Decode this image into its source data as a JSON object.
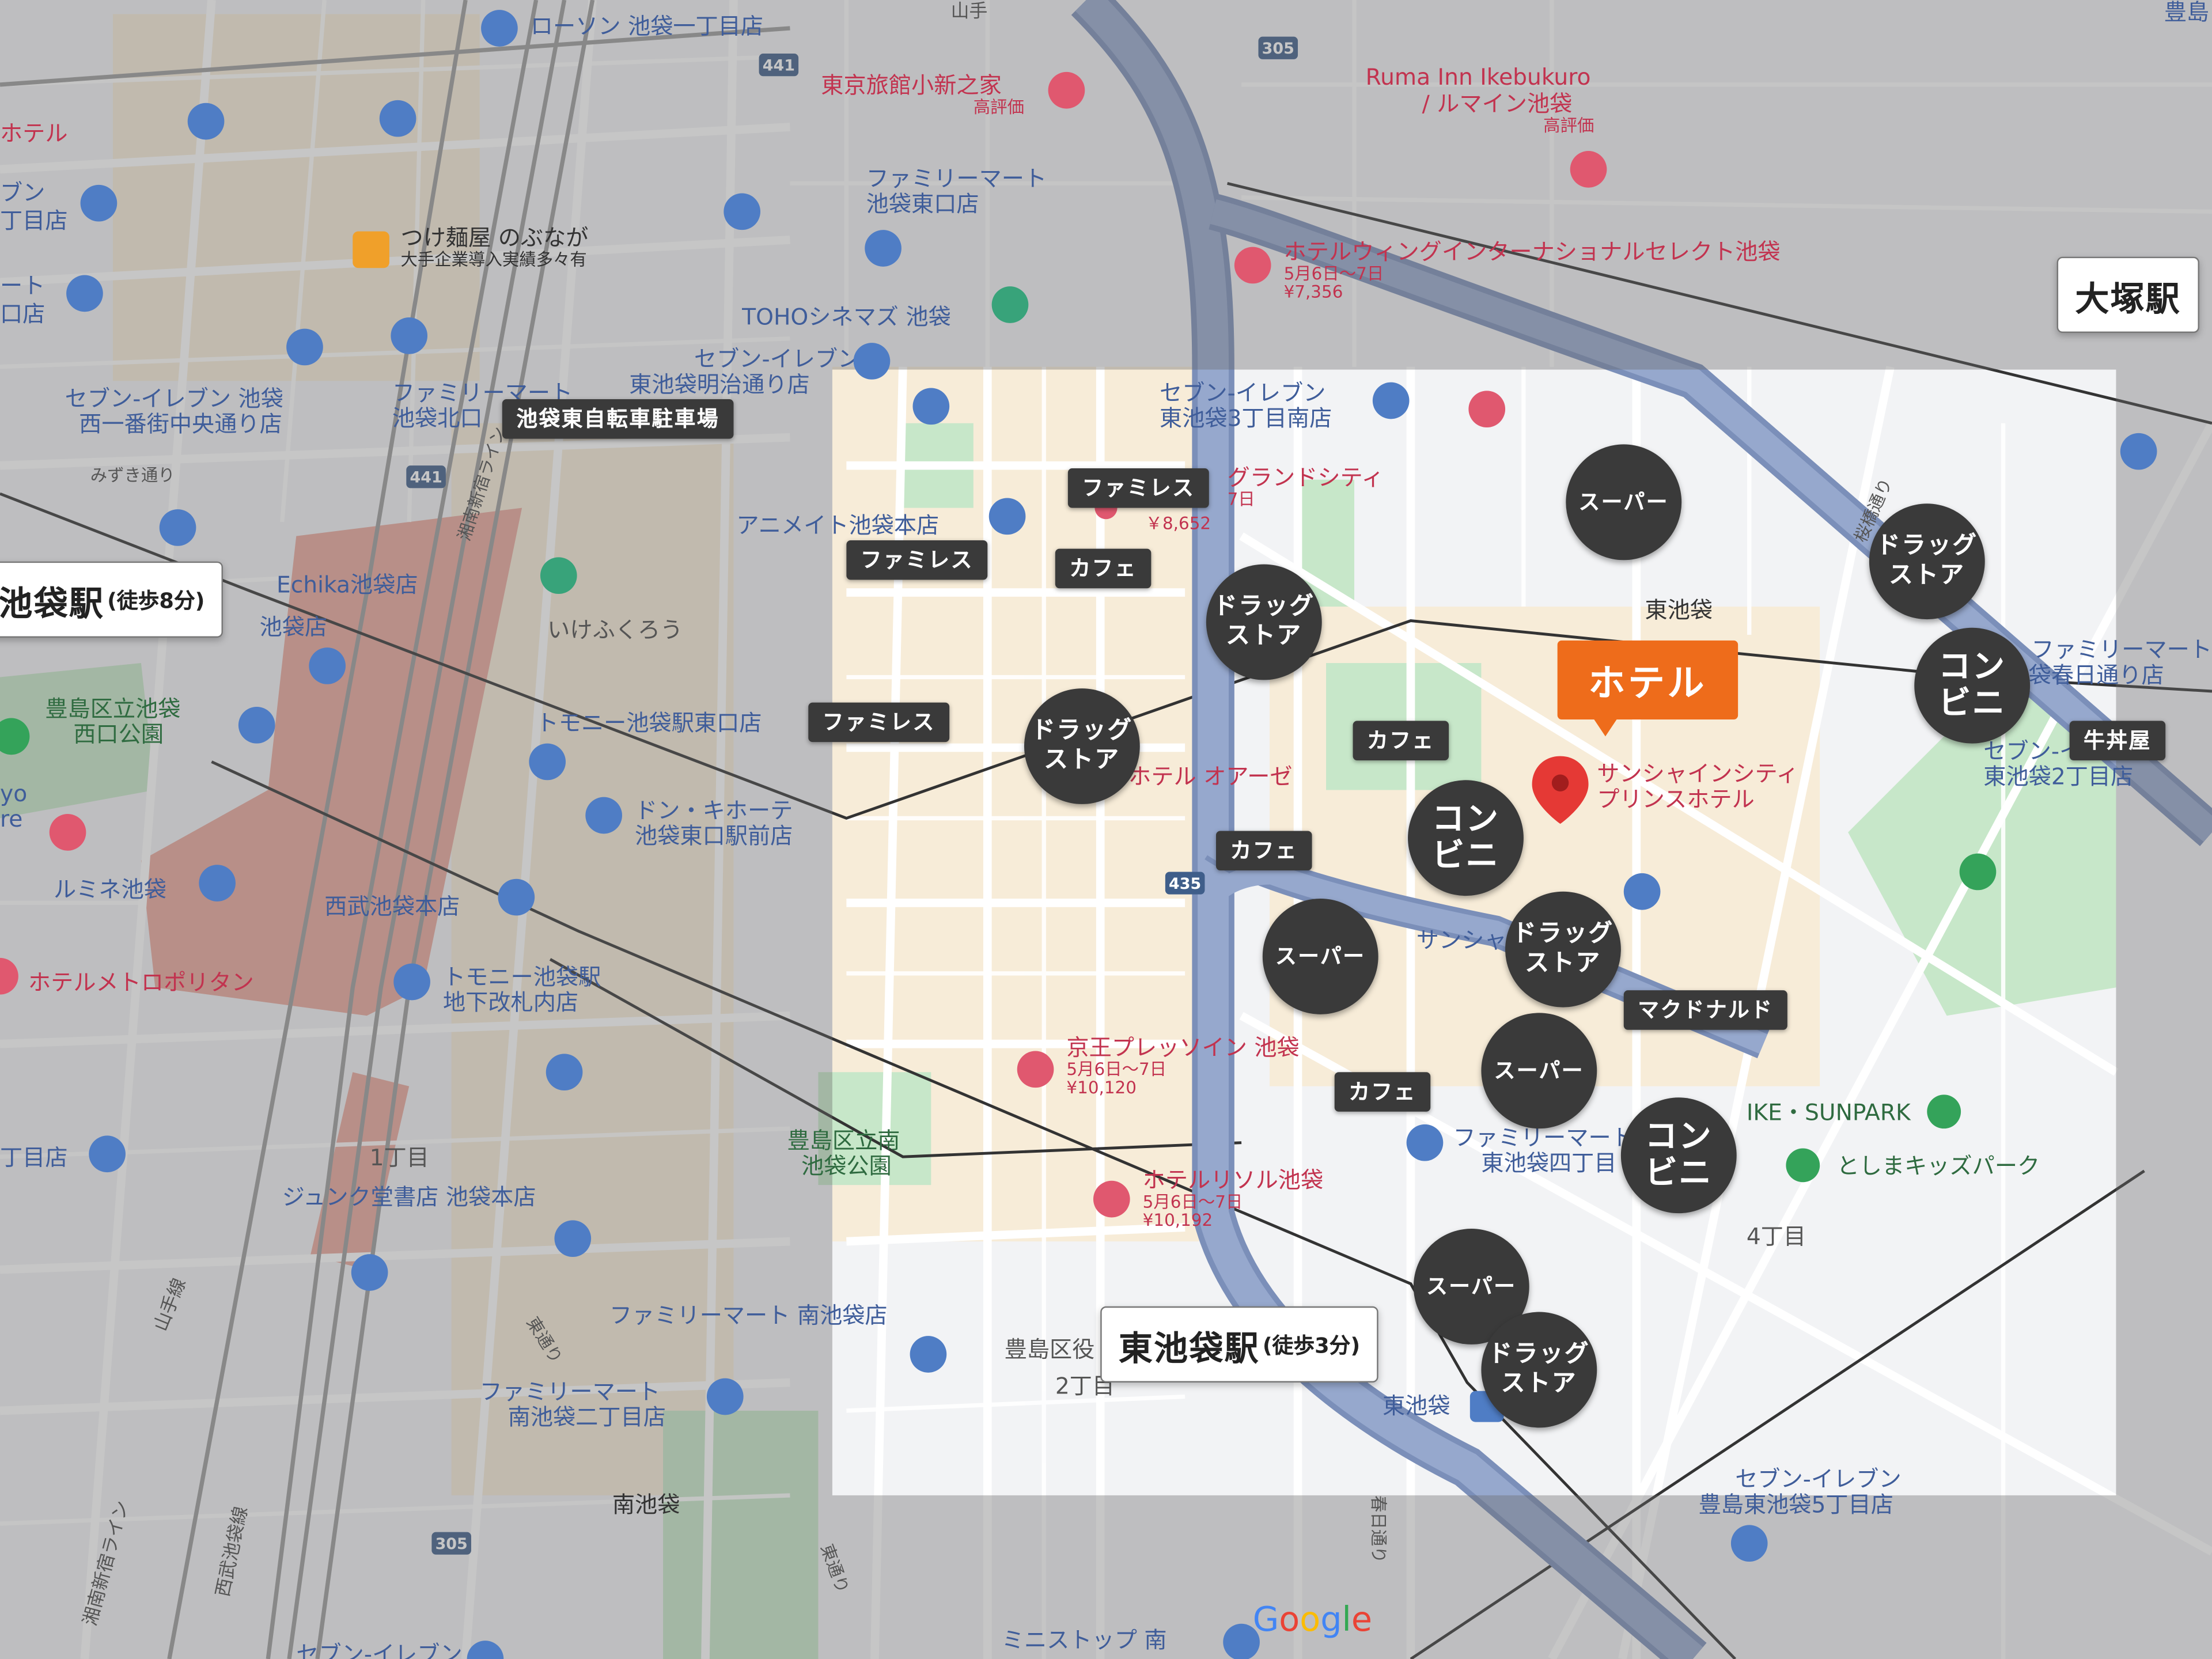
{
  "map_labels": [
    {
      "id": "lawson",
      "text": "ローソン 池袋一丁目店",
      "kind": "blue",
      "poi": "convenience-store-icon"
    },
    {
      "id": "ryokan",
      "text": "東京旅館小新之家",
      "sub": "高評価",
      "kind": "red",
      "poi": "hotel-icon"
    },
    {
      "id": "ruma1",
      "text": "Ruma Inn Ikebukuro",
      "kind": "red"
    },
    {
      "id": "ruma2",
      "text": "/ ルマイン池袋",
      "sub": "高評価",
      "kind": "red",
      "poi": "hotel-icon"
    },
    {
      "id": "hotel_left",
      "text": "ホテル",
      "kind": "red"
    },
    {
      "id": "fm_east",
      "text": "ファミリーマート",
      "sub2": "池袋東口店",
      "kind": "blue",
      "poi": "convenience-store-icon"
    },
    {
      "id": "tsukemen",
      "text": "つけ麺屋 のぶなが",
      "sub": "大手企業導入実績多々有",
      "kind": "dark",
      "poi": "restaurant-icon"
    },
    {
      "id": "wing",
      "text": "ホテルウィングインターナショナルセレクト池袋",
      "sub": "5月6日～7日",
      "sub3": "¥7,356",
      "kind": "red",
      "poi": "hotel-icon"
    },
    {
      "id": "toho",
      "text": "TOHOシネマズ 池袋",
      "kind": "blue",
      "poi": "cinema-icon"
    },
    {
      "id": "bun",
      "text": "ブン",
      "kind": "blue"
    },
    {
      "id": "chome_l",
      "text": "丁目店",
      "kind": "blue"
    },
    {
      "id": "to",
      "text": "ート",
      "kind": "blue"
    },
    {
      "id": "kuchiten",
      "text": "口店",
      "kind": "blue"
    },
    {
      "id": "seven_meiji",
      "text": "セブン-イレブン",
      "sub2": "東池袋明治通り店",
      "kind": "blue",
      "poi": "convenience-store-icon"
    },
    {
      "id": "seven_nishi",
      "text": "セブン-イレブン 池袋",
      "sub2": "西一番街中央通り店",
      "kind": "blue"
    },
    {
      "id": "fm_north",
      "text": "ファミリーマート",
      "sub2": "池袋北口",
      "kind": "blue"
    },
    {
      "id": "seven_3",
      "text": "セブン-イレブン",
      "sub2": "東池袋3丁目南店",
      "kind": "blue",
      "poi": "convenience-store-icon"
    },
    {
      "id": "mizuki",
      "text": "みずき通り",
      "kind": "gray"
    },
    {
      "id": "grand",
      "text": "グランドシティ",
      "sub": "7日",
      "kind": "red"
    },
    {
      "id": "price8652",
      "text": "￥8,652",
      "kind": "red"
    },
    {
      "id": "animate",
      "text": "アニメイト池袋本店",
      "kind": "blue",
      "poi": "shopping-icon"
    },
    {
      "id": "echika",
      "text": "Echika池袋店",
      "kind": "blue"
    },
    {
      "id": "ikebukuroten",
      "text": "池袋店",
      "kind": "blue"
    },
    {
      "id": "shonan1",
      "text": "湘南新宿ライン",
      "kind": "gray"
    },
    {
      "id": "ikefukuro",
      "text": "いけふくろう",
      "kind": "gray",
      "poi": "landmark-icon"
    },
    {
      "id": "higashiike",
      "text": "東池袋",
      "kind": "dark"
    },
    {
      "id": "sakura",
      "text": "桜橋通り",
      "kind": "gray"
    },
    {
      "id": "toshima_park",
      "text": "豊島区立池袋",
      "sub2": "西口公園",
      "kind": "green",
      "poi": "park-icon"
    },
    {
      "id": "tomony_east",
      "text": "トモニー池袋駅東口店",
      "kind": "blue",
      "poi": "convenience-store-icon"
    },
    {
      "id": "fm_kasuga",
      "text": "ファミリーマート",
      "sub2": "池袋春日通り店",
      "kind": "blue"
    },
    {
      "id": "yo",
      "text": "yo",
      "sub2": "re",
      "kind": "blue"
    },
    {
      "id": "donki",
      "text": "ドン・キホーテ",
      "sub2": "池袋東口駅前店",
      "kind": "blue",
      "poi": "shopping-icon"
    },
    {
      "id": "oase",
      "text": "ホテル オアーゼ",
      "kind": "red"
    },
    {
      "id": "sunshine_hotel",
      "text": "サンシャインシティ",
      "sub2": "プリンスホテル",
      "kind": "red",
      "poi": "location-pin-icon"
    },
    {
      "id": "seven_2",
      "text": "セブン-イレブン",
      "sub2": "東池袋2丁目店",
      "kind": "blue"
    },
    {
      "id": "lumine",
      "text": "ルミネ池袋",
      "kind": "blue",
      "poi": "shopping-icon"
    },
    {
      "id": "seibu",
      "text": "西武池袋本店",
      "kind": "blue",
      "poi": "shopping-icon"
    },
    {
      "id": "aquarium",
      "text": "サンシャイン水族館",
      "kind": "blue",
      "poi": "aquarium-icon"
    },
    {
      "id": "metropolitan",
      "text": "ホテルメトロポリタン",
      "kind": "red"
    },
    {
      "id": "tomony_under",
      "text": "トモニー池袋駅",
      "sub2": "地下改札内店",
      "kind": "blue",
      "poi": "convenience-store-icon"
    },
    {
      "id": "keio",
      "text": "京王プレッソイン 池袋",
      "sub": "5月6日～7日",
      "sub3": "¥10,120",
      "kind": "red",
      "poi": "hotel-icon"
    },
    {
      "id": "sunpark",
      "text": "IKE・SUNPARK",
      "kind": "green",
      "poi": "park-icon"
    },
    {
      "id": "fm_4",
      "text": "ファミリーマート",
      "sub2": "東池袋四丁目",
      "kind": "blue"
    },
    {
      "id": "kids",
      "text": "としまキッズパーク",
      "kind": "green",
      "poi": "park-icon"
    },
    {
      "id": "chome_l2",
      "text": "丁目店",
      "kind": "blue"
    },
    {
      "id": "chome1",
      "text": "1丁目",
      "kind": "gray"
    },
    {
      "id": "minami_park",
      "text": "豊島区立南",
      "sub2": "池袋公園",
      "kind": "green"
    },
    {
      "id": "resol",
      "text": "ホテルリソル池袋",
      "sub": "5月6日～7日",
      "sub3": "¥10,192",
      "kind": "red",
      "poi": "hotel-icon"
    },
    {
      "id": "junku",
      "text": "ジュンク堂書店 池袋本店",
      "kind": "blue",
      "poi": "shopping-icon"
    },
    {
      "id": "chome4",
      "text": "4丁目",
      "kind": "gray"
    },
    {
      "id": "yamanote",
      "text": "山手線",
      "kind": "gray"
    },
    {
      "id": "fm_minami",
      "text": "ファミリーマート 南池袋店",
      "kind": "blue",
      "poi": "convenience-store-icon"
    },
    {
      "id": "higashi_dori",
      "text": "東通り",
      "kind": "gray"
    },
    {
      "id": "toshimaku",
      "text": "豊島区役",
      "kind": "gray"
    },
    {
      "id": "chome2",
      "text": "2丁目",
      "kind": "gray"
    },
    {
      "id": "higashiike_st",
      "text": "東池袋",
      "kind": "blue",
      "poi": "train-icon"
    },
    {
      "id": "fm_minami2",
      "text": "ファミリーマート",
      "sub2": "南池袋二丁目店",
      "kind": "blue",
      "poi": "convenience-store-icon"
    },
    {
      "id": "shonan2",
      "text": "湘南新宿ライン",
      "kind": "gray"
    },
    {
      "id": "seibu_line",
      "text": "西武池袋線",
      "kind": "gray"
    },
    {
      "id": "minami_ike",
      "text": "南池袋",
      "kind": "dark"
    },
    {
      "id": "higashi_dori2",
      "text": "東通り",
      "kind": "gray"
    },
    {
      "id": "seven_5",
      "text": "セブン-イレブン",
      "sub2": "豊島東池袋5丁目店",
      "kind": "blue"
    },
    {
      "id": "ministop",
      "text": "ミニストップ 南",
      "kind": "blue"
    },
    {
      "id": "seven_bottom",
      "text": "セブン-イレブン",
      "kind": "blue"
    },
    {
      "id": "yamanote_top",
      "text": "山手",
      "kind": "gray"
    },
    {
      "id": "toshima_top",
      "text": "豊島",
      "kind": "blue"
    },
    {
      "id": "kasuga_dori",
      "text": "春日通り",
      "kind": "gray"
    }
  ],
  "road_numbers": [
    "441",
    "305",
    "441",
    "435",
    "305"
  ],
  "overlay": {
    "hotel_label": "ホテル",
    "stations": [
      {
        "id": "ikebukuro",
        "name": "池袋駅",
        "walk": "(徒歩8分)"
      },
      {
        "id": "higashi_ikebukuro",
        "name": "東池袋駅",
        "walk": "(徒歩3分)"
      },
      {
        "id": "otsuka",
        "name": "大塚駅",
        "walk": ""
      }
    ],
    "circles": [
      {
        "id": "c1",
        "text": "スーパー",
        "size": "s1"
      },
      {
        "id": "c2",
        "text": "ドラッグ\nストア",
        "size": "s2"
      },
      {
        "id": "c3",
        "text": "ドラッグ\nストア",
        "size": "s2"
      },
      {
        "id": "c4",
        "text": "ドラッグ\nストア",
        "size": "s2"
      },
      {
        "id": "c5",
        "text": "コン\nビニ",
        "size": "s3"
      },
      {
        "id": "c6",
        "text": "コン\nビニ",
        "size": "s3"
      },
      {
        "id": "c7",
        "text": "スーパー",
        "size": "s1"
      },
      {
        "id": "c8",
        "text": "ドラッグ\nストア",
        "size": "s2"
      },
      {
        "id": "c9",
        "text": "スーパー",
        "size": "s1"
      },
      {
        "id": "c10",
        "text": "コン\nビニ",
        "size": "s3"
      },
      {
        "id": "c11",
        "text": "スーパー",
        "size": "s1"
      },
      {
        "id": "c12",
        "text": "ドラッグ\nストア",
        "size": "s2"
      }
    ],
    "tags": [
      {
        "id": "t1",
        "text": "池袋東自転車駐車場"
      },
      {
        "id": "t2",
        "text": "ファミレス"
      },
      {
        "id": "t3",
        "text": "ファミレス"
      },
      {
        "id": "t4",
        "text": "カフェ"
      },
      {
        "id": "t5",
        "text": "ファミレス"
      },
      {
        "id": "t6",
        "text": "カフェ"
      },
      {
        "id": "t7",
        "text": "カフェ"
      },
      {
        "id": "t8",
        "text": "マクドナルド"
      },
      {
        "id": "t9",
        "text": "カフェ"
      },
      {
        "id": "t10",
        "text": "牛丼屋"
      }
    ]
  },
  "attribution": "Google",
  "colors": {
    "hotel": "#ee6c1b",
    "marker": "#3a3a3a",
    "expressway": "#8ea0c4",
    "rail_area": "#e8a79c",
    "park": "#c7e7c9"
  }
}
